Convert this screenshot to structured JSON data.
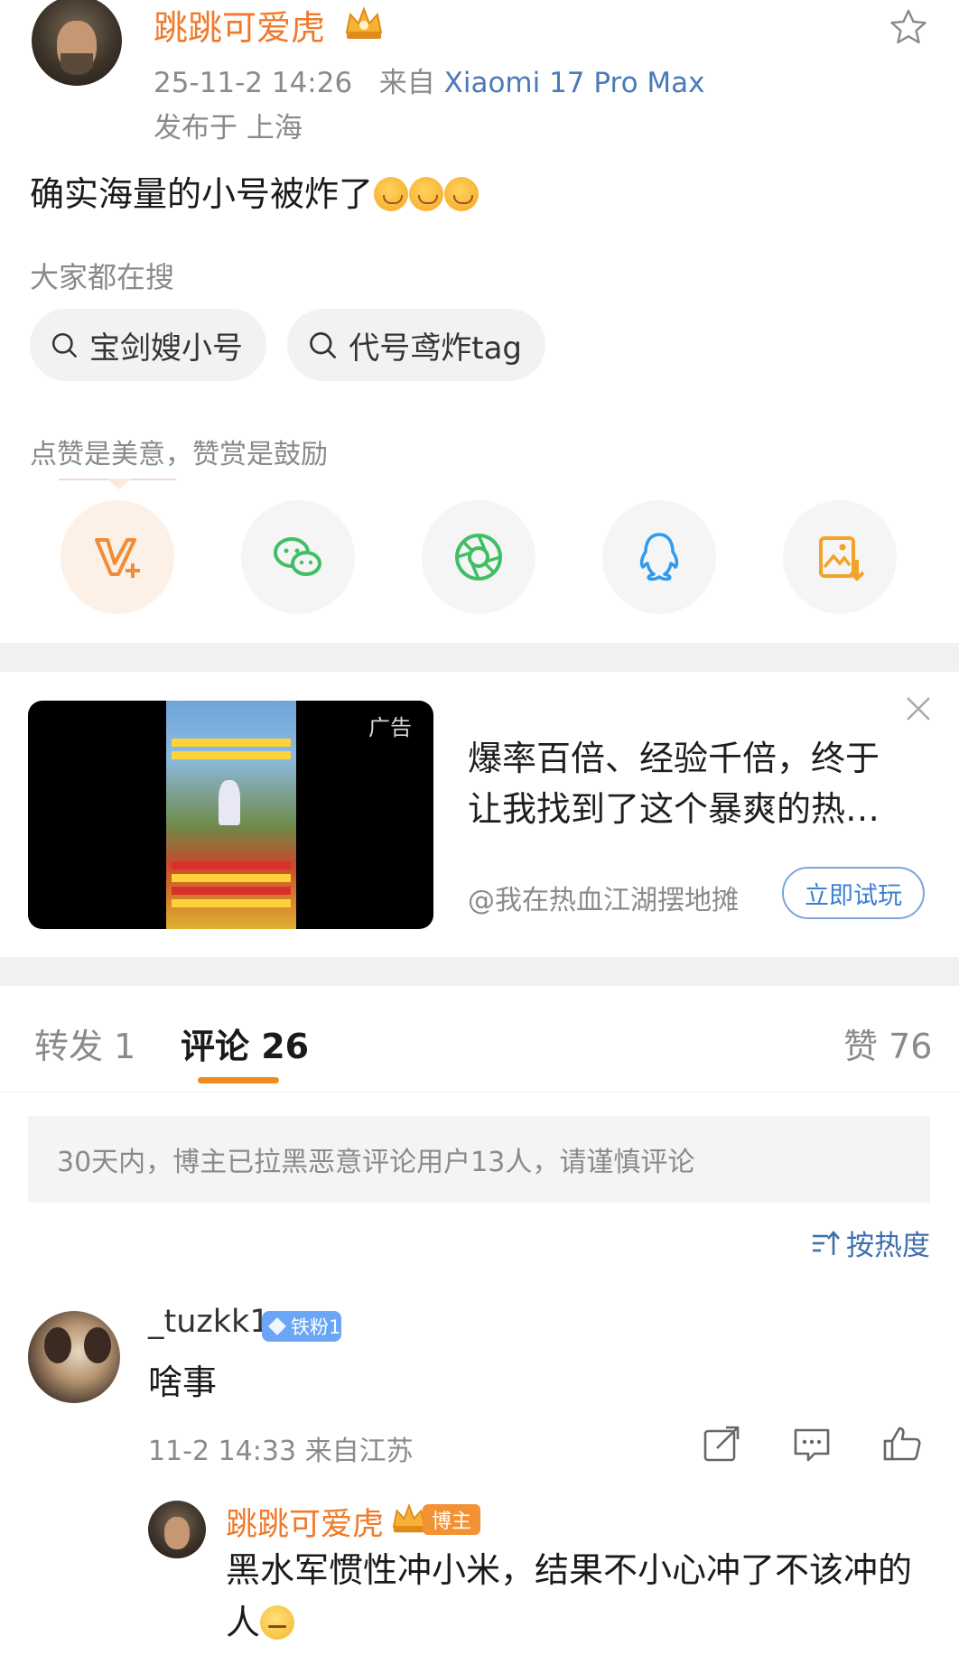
{
  "post": {
    "username": "跳跳可爱虎",
    "timestamp": "25-11-2 14:26",
    "source_prefix": "来自",
    "device": "Xiaomi 17 Pro Max",
    "location": "发布于 上海",
    "text": "确实海量的小号被炸了"
  },
  "search": {
    "title": "大家都在搜",
    "chips": [
      "宝剑嫂小号",
      "代号鸢炸tag"
    ]
  },
  "reward": {
    "hint": "点赞是美意，赞赏是鼓励",
    "share_icons": [
      "vplus-icon",
      "wechat-icon",
      "moments-icon",
      "qq-icon",
      "save-image-icon"
    ],
    "colors": {
      "vplus": "#f08c3a",
      "wechat": "#3fbf63",
      "moments": "#3fbf63",
      "qq": "#2f9bf0",
      "save": "#f2a32a"
    }
  },
  "ad": {
    "label": "广告",
    "title_line1": "爆率百倍、经验千倍，终于",
    "title_line2": "让我找到了这个暴爽的热…",
    "account": "@我在热血江湖摆地摊",
    "cta": "立即试玩"
  },
  "tabs": {
    "repost": "转发 1",
    "comment": "评论 26",
    "like": "赞 76",
    "accent": "#f08c1e"
  },
  "notice": "30天内，博主已拉黑恶意评论用户13人，请谨慎评论",
  "sort_label": "按热度",
  "comment": {
    "username": "_tuzkk1",
    "badge": "铁粉1",
    "text": "啥事",
    "meta": "11-2 14:33 来自江苏"
  },
  "reply": {
    "username": "跳跳可爱虎",
    "badge": "博主",
    "text": "黑水军惯性冲小米，结果不小心冲了不该冲的人"
  }
}
